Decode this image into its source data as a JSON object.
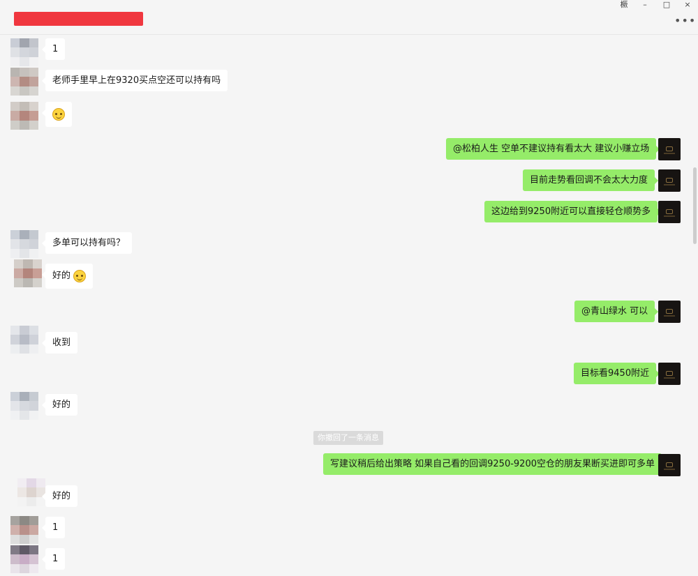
{
  "window": {
    "controls": {
      "pin": "橛",
      "minimize": "–",
      "maximize": "□",
      "close": "×"
    },
    "more_icon": "•••"
  },
  "messages": {
    "m1": "1",
    "m2": "老师手里早上在9320买点空还可以持有吗",
    "m4": "@松柏人生 空单不建议持有看太大 建议小赚立场",
    "m5": "目前走势看回调不会太大力度",
    "m6": "这边给到9250附近可以直接轻仓顺势多",
    "m7": "多单可以持有吗？",
    "m8": "好的",
    "m9": "@青山绿水 可以",
    "m10": "收到",
    "m11": "目标看9450附近",
    "m12": "好的",
    "system": "你撤回了一条消息",
    "m13": "写建议稍后给出策略 如果自己看的回调9250-9200空仓的朋友果断买进即可多单",
    "m14": "好的",
    "m15": "1",
    "m16": "1"
  },
  "colors": {
    "outgoing_bubble": "#95ec69",
    "incoming_bubble": "#ffffff",
    "redaction": "#f0373f",
    "background": "#f5f5f5"
  },
  "icons": [
    "pin-icon",
    "minimize-icon",
    "maximize-icon",
    "close-icon",
    "more-icon",
    "smiley-emoji-icon"
  ]
}
